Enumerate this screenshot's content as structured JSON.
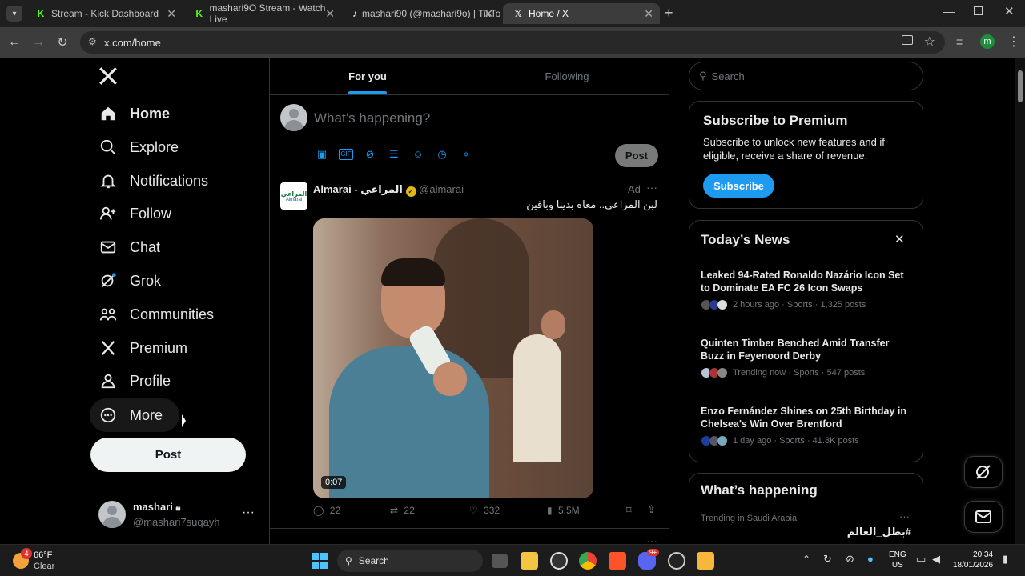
{
  "browser": {
    "tabs": [
      {
        "label": "Stream - Kick Dashboard",
        "icon": "kick-icon"
      },
      {
        "label": "mashari9O Stream - Watch Live",
        "icon": "kick-icon"
      },
      {
        "label": "mashari90 (@mashari9o) | TikTo",
        "icon": "tiktok-icon"
      },
      {
        "label": "Home / X",
        "icon": "x-icon"
      }
    ],
    "url": "x.com/home",
    "profile_initial": "m"
  },
  "nav": {
    "items": [
      {
        "label": "Home",
        "icon": "home-icon"
      },
      {
        "label": "Explore",
        "icon": "search-icon"
      },
      {
        "label": "Notifications",
        "icon": "bell-icon"
      },
      {
        "label": "Follow",
        "icon": "add-user-icon"
      },
      {
        "label": "Chat",
        "icon": "mail-icon"
      },
      {
        "label": "Grok",
        "icon": "grok-icon"
      },
      {
        "label": "Communities",
        "icon": "communities-icon"
      },
      {
        "label": "Premium",
        "icon": "x-icon"
      },
      {
        "label": "Profile",
        "icon": "person-icon"
      },
      {
        "label": "More",
        "icon": "more-circle-icon"
      }
    ],
    "post_label": "Post",
    "account": {
      "name": "mashari",
      "handle": "@mashari7suqayh"
    }
  },
  "timeline": {
    "tabs": [
      "For you",
      "Following"
    ],
    "composer_placeholder": "What’s happening?",
    "composer_post": "Post",
    "tweet": {
      "name": "Almarai - المراعي",
      "handle": "@almarai",
      "ad_label": "Ad",
      "text": "لبن المراعي.. معاه بدينا وباقين",
      "video_time": "0:07",
      "replies": "22",
      "reposts": "22",
      "likes": "332",
      "views": "5.5M",
      "avatar_text_ar": "المراعي",
      "avatar_text_en": "Almarai"
    }
  },
  "sidebar": {
    "search_placeholder": "Search",
    "premium": {
      "title": "Subscribe to Premium",
      "body": "Subscribe to unlock new features and if eligible, receive a share of revenue.",
      "button": "Subscribe"
    },
    "news": {
      "title": "Today’s News",
      "items": [
        {
          "headline": "Leaked 94-Rated Ronaldo Nazário Icon Set to Dominate EA FC 26 Icon Swaps",
          "meta": "2 hours ago · Sports · 1,325 posts"
        },
        {
          "headline": "Quinten Timber Benched Amid Transfer Buzz in Feyenoord Derby",
          "meta": "Trending now · Sports · 547 posts"
        },
        {
          "headline": "Enzo Fernández Shines on 25th Birthday in Chelsea's Win Over Brentford",
          "meta": "1 day ago · Sports · 41.8K posts"
        }
      ]
    },
    "happening": {
      "title": "What’s happening",
      "trend_context": "Trending in Saudi Arabia",
      "trend_name": "#بطل_العالم"
    }
  },
  "taskbar": {
    "weather_temp": "66°F",
    "weather_desc": "Clear",
    "weather_badge": "4",
    "search_label": "Search",
    "lang_top": "ENG",
    "lang_bottom": "US",
    "time": "20:34",
    "date": "18/01/2026",
    "discord_badge": "9+"
  },
  "colors": {
    "accent": "#1d9bf0",
    "bg": "#000000",
    "border": "#2f3336",
    "muted": "#71767b"
  }
}
